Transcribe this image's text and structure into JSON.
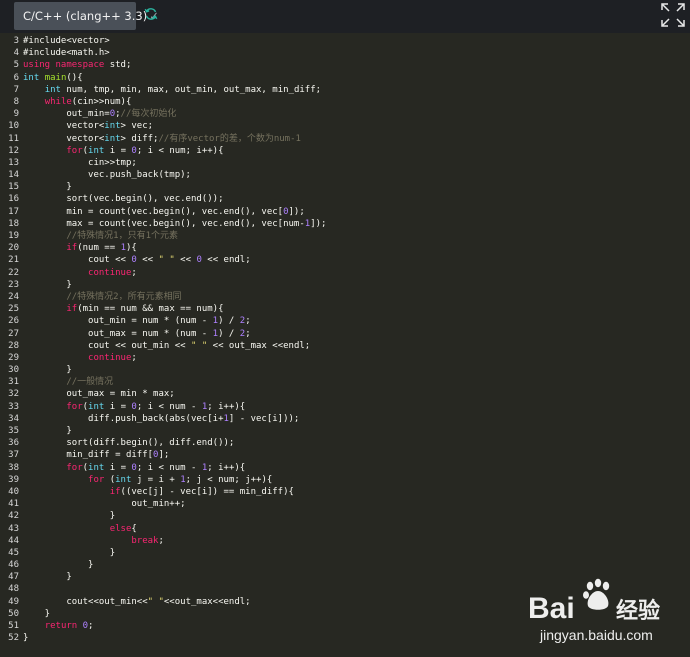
{
  "toolbar": {
    "language_tab": "C/C++ (clang++ 3.3)",
    "language_tab_check": "✓",
    "refresh_icon": "refresh-icon",
    "expand_icon": "expand-icon"
  },
  "editor": {
    "lines": [
      {
        "n": "3",
        "tokens": [
          [
            "p",
            "#include<vector>"
          ]
        ]
      },
      {
        "n": "4",
        "tokens": [
          [
            "p",
            "#include<math.h>"
          ]
        ]
      },
      {
        "n": "5",
        "tokens": [
          [
            "k",
            "using namespace"
          ],
          [
            "p",
            " std;"
          ]
        ]
      },
      {
        "n": "6",
        "tokens": [
          [
            "t",
            "int"
          ],
          [
            "p",
            " "
          ],
          [
            "f",
            "main"
          ],
          [
            "p",
            "(){"
          ]
        ]
      },
      {
        "n": "7",
        "tokens": [
          [
            "p",
            "    "
          ],
          [
            "t",
            "int"
          ],
          [
            "p",
            " num, tmp, min, max, out_min, out_max, min_diff;"
          ]
        ]
      },
      {
        "n": "8",
        "tokens": [
          [
            "p",
            "    "
          ],
          [
            "k",
            "while"
          ],
          [
            "p",
            "(cin>>num){"
          ]
        ]
      },
      {
        "n": "9",
        "tokens": [
          [
            "p",
            "        out_min="
          ],
          [
            "n",
            "0"
          ],
          [
            "p",
            ";"
          ],
          [
            "c",
            "//每次初始化"
          ]
        ]
      },
      {
        "n": "10",
        "tokens": [
          [
            "p",
            "        vector<"
          ],
          [
            "t",
            "int"
          ],
          [
            "p",
            "> vec;"
          ]
        ]
      },
      {
        "n": "11",
        "tokens": [
          [
            "p",
            "        vector<"
          ],
          [
            "t",
            "int"
          ],
          [
            "p",
            "> diff;"
          ],
          [
            "c",
            "//有序vector的差，个数为num-1"
          ]
        ]
      },
      {
        "n": "12",
        "tokens": [
          [
            "p",
            "        "
          ],
          [
            "k",
            "for"
          ],
          [
            "p",
            "("
          ],
          [
            "t",
            "int"
          ],
          [
            "p",
            " i = "
          ],
          [
            "n",
            "0"
          ],
          [
            "p",
            "; i < num; i++){"
          ]
        ]
      },
      {
        "n": "13",
        "tokens": [
          [
            "p",
            "            cin>>tmp;"
          ]
        ]
      },
      {
        "n": "14",
        "tokens": [
          [
            "p",
            "            vec.push_back(tmp);"
          ]
        ]
      },
      {
        "n": "15",
        "tokens": [
          [
            "p",
            "        }"
          ]
        ]
      },
      {
        "n": "16",
        "tokens": [
          [
            "p",
            "        sort(vec.begin(), vec.end());"
          ]
        ]
      },
      {
        "n": "17",
        "tokens": [
          [
            "p",
            "        min = count(vec.begin(), vec.end(), vec["
          ],
          [
            "n",
            "0"
          ],
          [
            "p",
            "]);"
          ]
        ]
      },
      {
        "n": "18",
        "tokens": [
          [
            "p",
            "        max = count(vec.begin(), vec.end(), vec[num-"
          ],
          [
            "n",
            "1"
          ],
          [
            "p",
            "]);"
          ]
        ]
      },
      {
        "n": "19",
        "tokens": [
          [
            "c",
            "        //特殊情况1，只有1个元素"
          ]
        ]
      },
      {
        "n": "20",
        "tokens": [
          [
            "p",
            "        "
          ],
          [
            "k",
            "if"
          ],
          [
            "p",
            "(num == "
          ],
          [
            "n",
            "1"
          ],
          [
            "p",
            "){"
          ]
        ]
      },
      {
        "n": "21",
        "tokens": [
          [
            "p",
            "            cout << "
          ],
          [
            "n",
            "0"
          ],
          [
            "p",
            " << "
          ],
          [
            "s",
            "\" \""
          ],
          [
            "p",
            " << "
          ],
          [
            "n",
            "0"
          ],
          [
            "p",
            " << endl;"
          ]
        ]
      },
      {
        "n": "22",
        "tokens": [
          [
            "p",
            "            "
          ],
          [
            "k",
            "continue"
          ],
          [
            "p",
            ";"
          ]
        ]
      },
      {
        "n": "23",
        "tokens": [
          [
            "p",
            "        }"
          ]
        ]
      },
      {
        "n": "24",
        "tokens": [
          [
            "c",
            "        //特殊情况2，所有元素相同"
          ]
        ]
      },
      {
        "n": "25",
        "tokens": [
          [
            "p",
            "        "
          ],
          [
            "k",
            "if"
          ],
          [
            "p",
            "(min == num && max == num){"
          ]
        ]
      },
      {
        "n": "26",
        "tokens": [
          [
            "p",
            "            out_min = num * (num - "
          ],
          [
            "n",
            "1"
          ],
          [
            "p",
            ") / "
          ],
          [
            "n",
            "2"
          ],
          [
            "p",
            ";"
          ]
        ]
      },
      {
        "n": "27",
        "tokens": [
          [
            "p",
            "            out_max = num * (num - "
          ],
          [
            "n",
            "1"
          ],
          [
            "p",
            ") / "
          ],
          [
            "n",
            "2"
          ],
          [
            "p",
            ";"
          ]
        ]
      },
      {
        "n": "28",
        "tokens": [
          [
            "p",
            "            cout << out_min << "
          ],
          [
            "s",
            "\" \""
          ],
          [
            "p",
            " << out_max <<endl;"
          ]
        ]
      },
      {
        "n": "29",
        "tokens": [
          [
            "p",
            "            "
          ],
          [
            "k",
            "continue"
          ],
          [
            "p",
            ";"
          ]
        ]
      },
      {
        "n": "30",
        "tokens": [
          [
            "p",
            "        }"
          ]
        ]
      },
      {
        "n": "31",
        "tokens": [
          [
            "c",
            "        //一般情况"
          ]
        ]
      },
      {
        "n": "32",
        "tokens": [
          [
            "p",
            "        out_max = min * max;"
          ]
        ]
      },
      {
        "n": "33",
        "tokens": [
          [
            "p",
            "        "
          ],
          [
            "k",
            "for"
          ],
          [
            "p",
            "("
          ],
          [
            "t",
            "int"
          ],
          [
            "p",
            " i = "
          ],
          [
            "n",
            "0"
          ],
          [
            "p",
            "; i < num - "
          ],
          [
            "n",
            "1"
          ],
          [
            "p",
            "; i++){"
          ]
        ]
      },
      {
        "n": "34",
        "tokens": [
          [
            "p",
            "            diff.push_back(abs(vec[i+"
          ],
          [
            "n",
            "1"
          ],
          [
            "p",
            "] - vec[i]));"
          ]
        ]
      },
      {
        "n": "35",
        "tokens": [
          [
            "p",
            "        }"
          ]
        ]
      },
      {
        "n": "36",
        "tokens": [
          [
            "p",
            "        sort(diff.begin(), diff.end());"
          ]
        ]
      },
      {
        "n": "37",
        "tokens": [
          [
            "p",
            "        min_diff = diff["
          ],
          [
            "n",
            "0"
          ],
          [
            "p",
            "];"
          ]
        ]
      },
      {
        "n": "38",
        "tokens": [
          [
            "p",
            "        "
          ],
          [
            "k",
            "for"
          ],
          [
            "p",
            "("
          ],
          [
            "t",
            "int"
          ],
          [
            "p",
            " i = "
          ],
          [
            "n",
            "0"
          ],
          [
            "p",
            "; i < num - "
          ],
          [
            "n",
            "1"
          ],
          [
            "p",
            "; i++){"
          ]
        ]
      },
      {
        "n": "39",
        "tokens": [
          [
            "p",
            "            "
          ],
          [
            "k",
            "for"
          ],
          [
            "p",
            " ("
          ],
          [
            "t",
            "int"
          ],
          [
            "p",
            " j = i + "
          ],
          [
            "n",
            "1"
          ],
          [
            "p",
            "; j < num; j++){"
          ]
        ]
      },
      {
        "n": "40",
        "tokens": [
          [
            "p",
            "                "
          ],
          [
            "k",
            "if"
          ],
          [
            "p",
            "((vec[j] - vec[i]) == min_diff){"
          ]
        ]
      },
      {
        "n": "41",
        "tokens": [
          [
            "p",
            "                    out_min++;"
          ]
        ]
      },
      {
        "n": "42",
        "tokens": [
          [
            "p",
            "                }"
          ]
        ]
      },
      {
        "n": "43",
        "tokens": [
          [
            "p",
            "                "
          ],
          [
            "k",
            "else"
          ],
          [
            "p",
            "{"
          ]
        ]
      },
      {
        "n": "44",
        "tokens": [
          [
            "p",
            "                    "
          ],
          [
            "k",
            "break"
          ],
          [
            "p",
            ";"
          ]
        ]
      },
      {
        "n": "45",
        "tokens": [
          [
            "p",
            "                }"
          ]
        ]
      },
      {
        "n": "46",
        "tokens": [
          [
            "p",
            "            }"
          ]
        ]
      },
      {
        "n": "47",
        "tokens": [
          [
            "p",
            "        }"
          ]
        ]
      },
      {
        "n": "48",
        "tokens": []
      },
      {
        "n": "49",
        "tokens": [
          [
            "p",
            "        cout<<out_min<<"
          ],
          [
            "s",
            "\" \""
          ],
          [
            "p",
            "<<out_max<<endl;"
          ]
        ]
      },
      {
        "n": "50",
        "tokens": [
          [
            "p",
            "    }"
          ]
        ]
      },
      {
        "n": "51",
        "tokens": [
          [
            "p",
            "    "
          ],
          [
            "k",
            "return"
          ],
          [
            "p",
            " "
          ],
          [
            "n",
            "0"
          ],
          [
            "p",
            ";"
          ]
        ]
      },
      {
        "n": "52",
        "tokens": [
          [
            "p",
            "}"
          ]
        ]
      }
    ]
  },
  "watermark": {
    "brand": "Bai",
    "brand2": "经验",
    "url": "jingyan.baidu.com"
  },
  "colors": {
    "editor_bg": "#272822",
    "topbar_bg": "#1e2024",
    "tab_bg": "#4a5058",
    "refresh_icon": "#2bb5a0"
  }
}
